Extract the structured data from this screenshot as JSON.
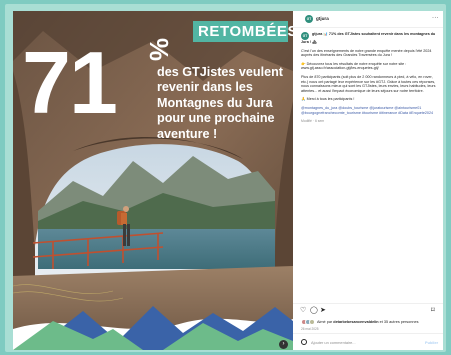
{
  "post": {
    "badge": "RETOMBÉES",
    "big_number": "71",
    "percent": "%",
    "headline_lines": [
      "des GTJistes veulent",
      "revenir dans les",
      "Montagnes du Jura",
      "pour une prochaine",
      "aventure !"
    ]
  },
  "side": {
    "username": "gtjura",
    "avatar_text": "GT",
    "caption": {
      "intro_user": "gtjura",
      "intro_bold": "📊 71% des GTJistes souhaitent revenir dans les montagnes du Jura ! 🏔",
      "p1": "C'est l'un des enseignements de notre grande enquête menée depuis l'été 2024 auprès des itinérants des Grandes Traversées du Jura !",
      "p2": "👉 Découvrez tous les résultats de notre enquête sur notre site : www.gtj.asso.fr/association-gtj/les-enquetes-gtj/",
      "p3": "Plus de 870 participants (soit plus de 2 000 randonneurs à pied, à vélo, en rover, etc.) nous ont partagé leur expérience sur les #GTJ. Grâce à toutes ces réponses, nous connaissons mieux qui sont les GTJistes, leurs envies, leurs habitudes, leurs attentes... et aussi l'impact économique de leurs séjours sur notre territoire.",
      "p4": "🙏 Merci à tous les participants !",
      "hashtags": "@montagnes_du_jura @doubs_tourisme @juratourisme @aintourisme01 @bourgognefranchecomte_tourisme #tourisme #itinerance #Data #Enquete2024",
      "meta": "Modifié · 6 sem"
    },
    "likes_prefix": "Aimé par ",
    "likes_user": "detarbebesancenvaldelin",
    "likes_suffix": " et 35 autres personnes",
    "date": "26 mai 2025",
    "comment_placeholder": "Ajouter un commentaire...",
    "publish_label": "Publier"
  },
  "colors": {
    "frame": "#7fcbc1",
    "badge": "#52b5a3",
    "accent_green": "#6dbb8a"
  }
}
